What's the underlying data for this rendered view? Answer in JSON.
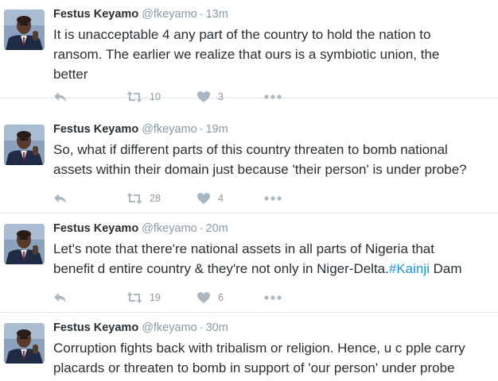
{
  "tweets": [
    {
      "name": "Festus Keyamo",
      "handle": "@fkeyamo",
      "separator": "·",
      "time": "13m",
      "lines": [
        "It is unacceptable 4 any part of the country to hold the nation to",
        "ransom. The earlier we realize that ours is a symbiotic union, the",
        "better"
      ],
      "retweets": "10",
      "likes": "3"
    },
    {
      "name": "Festus Keyamo",
      "handle": "@fkeyamo",
      "separator": "·",
      "time": "19m",
      "lines": [
        "So, what if different parts of this country threaten to bomb national",
        "assets within their domain just because 'their person' is under probe?"
      ],
      "retweets": "28",
      "likes": "4"
    },
    {
      "name": "Festus Keyamo",
      "handle": "@fkeyamo",
      "separator": "·",
      "time": "20m",
      "lines": [
        "Let's note that there're national assets in all parts of Nigeria that"
      ],
      "line2_pre": "benefit d entire country & they're not only in Niger-Delta.",
      "line2_hashtag": "#Kainji",
      "line2_post": " Dam",
      "retweets": "19",
      "likes": "6"
    },
    {
      "name": "Festus Keyamo",
      "handle": "@fkeyamo",
      "separator": "·",
      "time": "30m",
      "lines": [
        "Corruption fights back with tribalism or religion. Hence, u c pple carry",
        "placards or threaten to bomb in support of 'our person' under probe"
      ]
    }
  ],
  "icons": {
    "reply": "reply-icon",
    "retweet": "retweet-icon",
    "like": "heart-icon",
    "more": "more-icon"
  },
  "colors": {
    "text": "#292f33",
    "secondary": "#8899a6",
    "icon": "#aab8c2",
    "hashtag": "#1b95e0",
    "divider": "#e1e8ed"
  }
}
